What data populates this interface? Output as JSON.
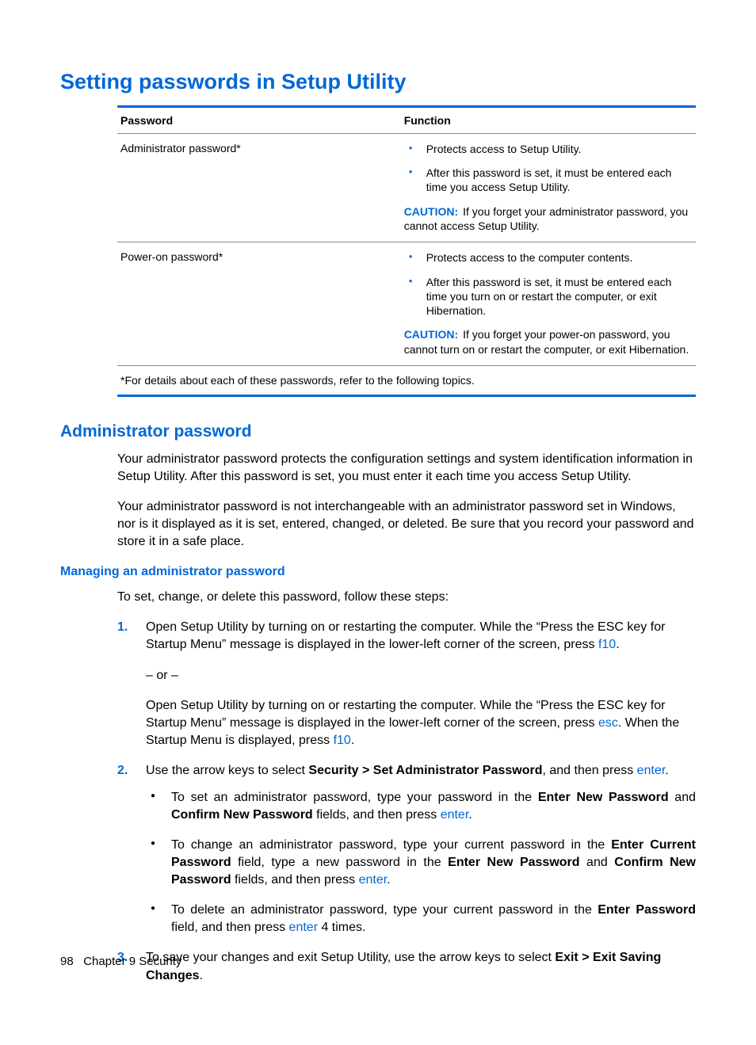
{
  "heading1": "Setting passwords in Setup Utility",
  "table": {
    "headers": {
      "password": "Password",
      "function": "Function"
    },
    "rows": [
      {
        "name": "Administrator password*",
        "bullets": [
          "Protects access to Setup Utility.",
          "After this password is set, it must be entered each time you access Setup Utility."
        ],
        "caution_label": "CAUTION:",
        "caution_text": "If you forget your administrator password, you cannot access Setup Utility."
      },
      {
        "name": "Power-on password*",
        "bullets": [
          "Protects access to the computer contents.",
          "After this password is set, it must be entered each time you turn on or restart the computer, or exit Hibernation."
        ],
        "caution_label": "CAUTION:",
        "caution_text": "If you forget your power-on password, you cannot turn on or restart the computer, or exit Hibernation."
      }
    ],
    "footer": "*For details about each of these passwords, refer to the following topics."
  },
  "heading2": "Administrator password",
  "admin_p1": "Your administrator password protects the configuration settings and system identification information in Setup Utility. After this password is set, you must enter it each time you access Setup Utility.",
  "admin_p2": "Your administrator password is not interchangeable with an administrator password set in Windows, nor is it displayed as it is set, entered, changed, or deleted. Be sure that you record your password and store it in a safe place.",
  "heading3": "Managing an administrator password",
  "mng_intro": "To set, change, or delete this password, follow these steps:",
  "steps": {
    "s1a_pre": "Open Setup Utility by turning on or restarting the computer. While the “Press the ESC key for Startup Menu” message is displayed in the lower-left corner of the screen, press ",
    "s1a_key": "f10",
    "s1a_post": ".",
    "s1_or": "– or –",
    "s1b_pre": "Open Setup Utility by turning on or restarting the computer. While the “Press the ESC key for Startup Menu” message is displayed in the lower-left corner of the screen, press ",
    "s1b_key1": "esc",
    "s1b_mid": ". When the Startup Menu is displayed, press ",
    "s1b_key2": "f10",
    "s1b_post": ".",
    "s2_pre": "Use the arrow keys to select ",
    "s2_bold": "Security > Set Administrator Password",
    "s2_mid": ", and then press ",
    "s2_key": "enter",
    "s2_post": ".",
    "s2_b1_a": "To set an administrator password, type your password in the ",
    "s2_b1_b1": "Enter New Password",
    "s2_b1_c": " and ",
    "s2_b1_b2": "Confirm New Password",
    "s2_b1_d": " fields, and then press ",
    "s2_b1_key": "enter",
    "s2_b1_e": ".",
    "s2_b2_a": "To change an administrator password, type your current password in the ",
    "s2_b2_b1": "Enter Current Password",
    "s2_b2_c": " field, type a new password in the ",
    "s2_b2_b2": "Enter New Password",
    "s2_b2_d": " and ",
    "s2_b2_b3": "Confirm New Password",
    "s2_b2_e": " fields, and then press ",
    "s2_b2_key": "enter",
    "s2_b2_f": ".",
    "s2_b3_a": "To delete an administrator password, type your current password in the ",
    "s2_b3_b1": "Enter Password",
    "s2_b3_c": " field, and then press ",
    "s2_b3_key": "enter",
    "s2_b3_d": " 4 times.",
    "s3_pre": "To save your changes and exit Setup Utility, use the arrow keys to select ",
    "s3_bold": "Exit > Exit Saving Changes",
    "s3_post": "."
  },
  "footer": {
    "page": "98",
    "chapter": "Chapter 9   Security"
  }
}
